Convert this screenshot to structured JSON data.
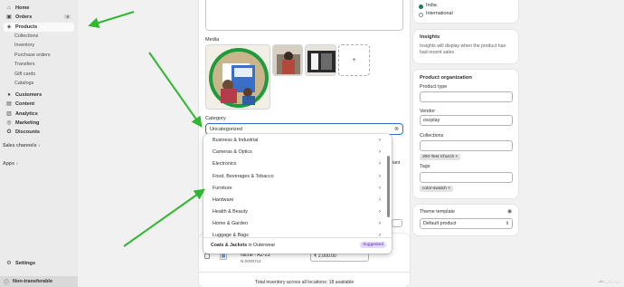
{
  "sidebar": {
    "items": [
      {
        "icon": "home-icon",
        "label": "Home"
      },
      {
        "icon": "orders-icon",
        "label": "Orders",
        "badge": "8"
      },
      {
        "icon": "products-icon",
        "label": "Products"
      }
    ],
    "product_subitems": [
      "Collections",
      "Inventory",
      "Purchase orders",
      "Transfers",
      "Gift cards",
      "Catalogs"
    ],
    "items2": [
      {
        "icon": "customers-icon",
        "label": "Customers"
      },
      {
        "icon": "content-icon",
        "label": "Content"
      },
      {
        "icon": "analytics-icon",
        "label": "Analytics"
      },
      {
        "icon": "marketing-icon",
        "label": "Marketing"
      },
      {
        "icon": "discounts-icon",
        "label": "Discounts"
      }
    ],
    "sales_channels_label": "Sales channels",
    "apps_label": "Apps",
    "settings_label": "Settings",
    "footer_label": "Non-transferable"
  },
  "main": {
    "media_label": "Media",
    "category_label": "Category",
    "category_value": "Uncategorized",
    "category_options": [
      "Business & Industrial",
      "Cameras & Optics",
      "Electronics",
      "Food, Beverages & Tobacco",
      "Furniture",
      "Hardware",
      "Health & Beauty",
      "Home & Garden",
      "Luggage & Bags"
    ],
    "suggestion": {
      "name": "Coats & Jackets",
      "connector": "in",
      "parent": "Outerwear",
      "badge": "Suggested"
    },
    "partial_right_label": "iant",
    "variant": {
      "name": "Niche - A2-23",
      "sku": "N-0000714",
      "price": "₹  2,000.00"
    },
    "total_inventory": "Total inventory across all locations: 18 available"
  },
  "right": {
    "markets": [
      "India",
      "International"
    ],
    "insights": {
      "title": "Insights",
      "desc": "Insights will display when the product has had recent sales"
    },
    "organization": {
      "title": "Product organization",
      "product_type_label": "Product type",
      "product_type_value": "",
      "vendor_label": "Vendor",
      "vendor_value": "oscplay",
      "collections_label": "Collections",
      "collections_value": "",
      "collection_tag": "300-Test Church",
      "tags_label": "Tags",
      "tags_value": "",
      "tag": "color-swatch"
    },
    "theme_template": {
      "title": "Theme template",
      "value": "Default product"
    }
  },
  "colors": {
    "accent": "#2c6ecb",
    "arrow": "#2fb82f",
    "sidebar_bg": "#ebebeb",
    "suggested_bg": "#e4d8fb"
  }
}
